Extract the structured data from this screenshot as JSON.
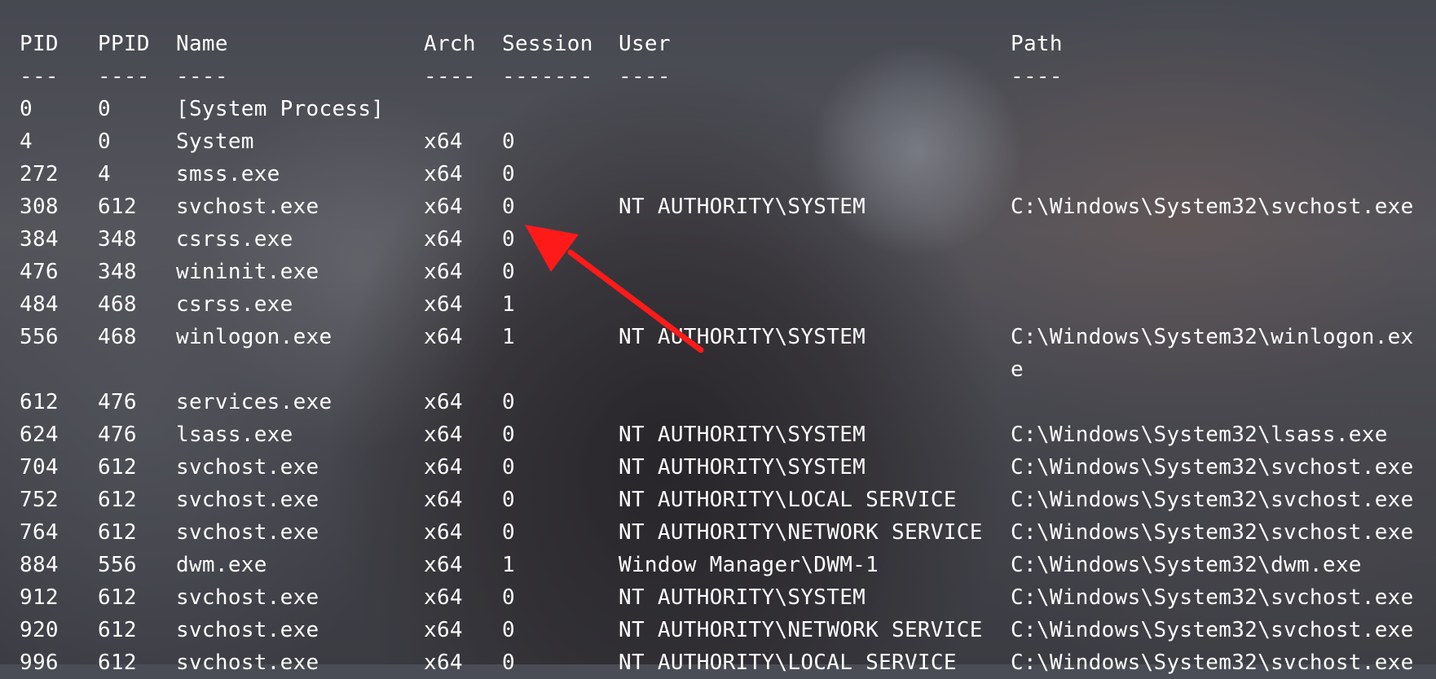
{
  "headers": {
    "pid": "PID",
    "ppid": "PPID",
    "name": "Name",
    "arch": "Arch",
    "session": "Session",
    "user": "User",
    "path": "Path"
  },
  "separators": {
    "pid": "---",
    "ppid": "----",
    "name": "----",
    "arch": "----",
    "session": "-------",
    "user": "----",
    "path": "----"
  },
  "processes": [
    {
      "pid": "0",
      "ppid": "0",
      "name": "[System Process]",
      "arch": "",
      "session": "",
      "user": "",
      "path": ""
    },
    {
      "pid": "4",
      "ppid": "0",
      "name": "System",
      "arch": "x64",
      "session": "0",
      "user": "",
      "path": ""
    },
    {
      "pid": "272",
      "ppid": "4",
      "name": "smss.exe",
      "arch": "x64",
      "session": "0",
      "user": "",
      "path": ""
    },
    {
      "pid": "308",
      "ppid": "612",
      "name": "svchost.exe",
      "arch": "x64",
      "session": "0",
      "user": "NT AUTHORITY\\SYSTEM",
      "path": "C:\\Windows\\System32\\svchost.exe"
    },
    {
      "pid": "384",
      "ppid": "348",
      "name": "csrss.exe",
      "arch": "x64",
      "session": "0",
      "user": "",
      "path": ""
    },
    {
      "pid": "476",
      "ppid": "348",
      "name": "wininit.exe",
      "arch": "x64",
      "session": "0",
      "user": "",
      "path": ""
    },
    {
      "pid": "484",
      "ppid": "468",
      "name": "csrss.exe",
      "arch": "x64",
      "session": "1",
      "user": "",
      "path": ""
    },
    {
      "pid": "556",
      "ppid": "468",
      "name": "winlogon.exe",
      "arch": "x64",
      "session": "1",
      "user": "NT AUTHORITY\\SYSTEM",
      "path": "C:\\Windows\\System32\\winlogon.ex\ne"
    },
    {
      "pid": "612",
      "ppid": "476",
      "name": "services.exe",
      "arch": "x64",
      "session": "0",
      "user": "",
      "path": ""
    },
    {
      "pid": "624",
      "ppid": "476",
      "name": "lsass.exe",
      "arch": "x64",
      "session": "0",
      "user": "NT AUTHORITY\\SYSTEM",
      "path": "C:\\Windows\\System32\\lsass.exe"
    },
    {
      "pid": "704",
      "ppid": "612",
      "name": "svchost.exe",
      "arch": "x64",
      "session": "0",
      "user": "NT AUTHORITY\\SYSTEM",
      "path": "C:\\Windows\\System32\\svchost.exe"
    },
    {
      "pid": "752",
      "ppid": "612",
      "name": "svchost.exe",
      "arch": "x64",
      "session": "0",
      "user": "NT AUTHORITY\\LOCAL SERVICE",
      "path": "C:\\Windows\\System32\\svchost.exe"
    },
    {
      "pid": "764",
      "ppid": "612",
      "name": "svchost.exe",
      "arch": "x64",
      "session": "0",
      "user": "NT AUTHORITY\\NETWORK SERVICE",
      "path": "C:\\Windows\\System32\\svchost.exe"
    },
    {
      "pid": "884",
      "ppid": "556",
      "name": "dwm.exe",
      "arch": "x64",
      "session": "1",
      "user": "Window Manager\\DWM-1",
      "path": "C:\\Windows\\System32\\dwm.exe"
    },
    {
      "pid": "912",
      "ppid": "612",
      "name": "svchost.exe",
      "arch": "x64",
      "session": "0",
      "user": "NT AUTHORITY\\SYSTEM",
      "path": "C:\\Windows\\System32\\svchost.exe"
    },
    {
      "pid": "920",
      "ppid": "612",
      "name": "svchost.exe",
      "arch": "x64",
      "session": "0",
      "user": "NT AUTHORITY\\NETWORK SERVICE",
      "path": "C:\\Windows\\System32\\svchost.exe"
    },
    {
      "pid": "996",
      "ppid": "612",
      "name": "svchost.exe",
      "arch": "x64",
      "session": "0",
      "user": "NT AUTHORITY\\LOCAL SERVICE",
      "path": "C:\\Windows\\System32\\svchost.exe"
    }
  ],
  "annotation": {
    "icon": "red-arrow-icon",
    "color": "#ff1a1a"
  },
  "colors": {
    "text": "#ffffff"
  }
}
